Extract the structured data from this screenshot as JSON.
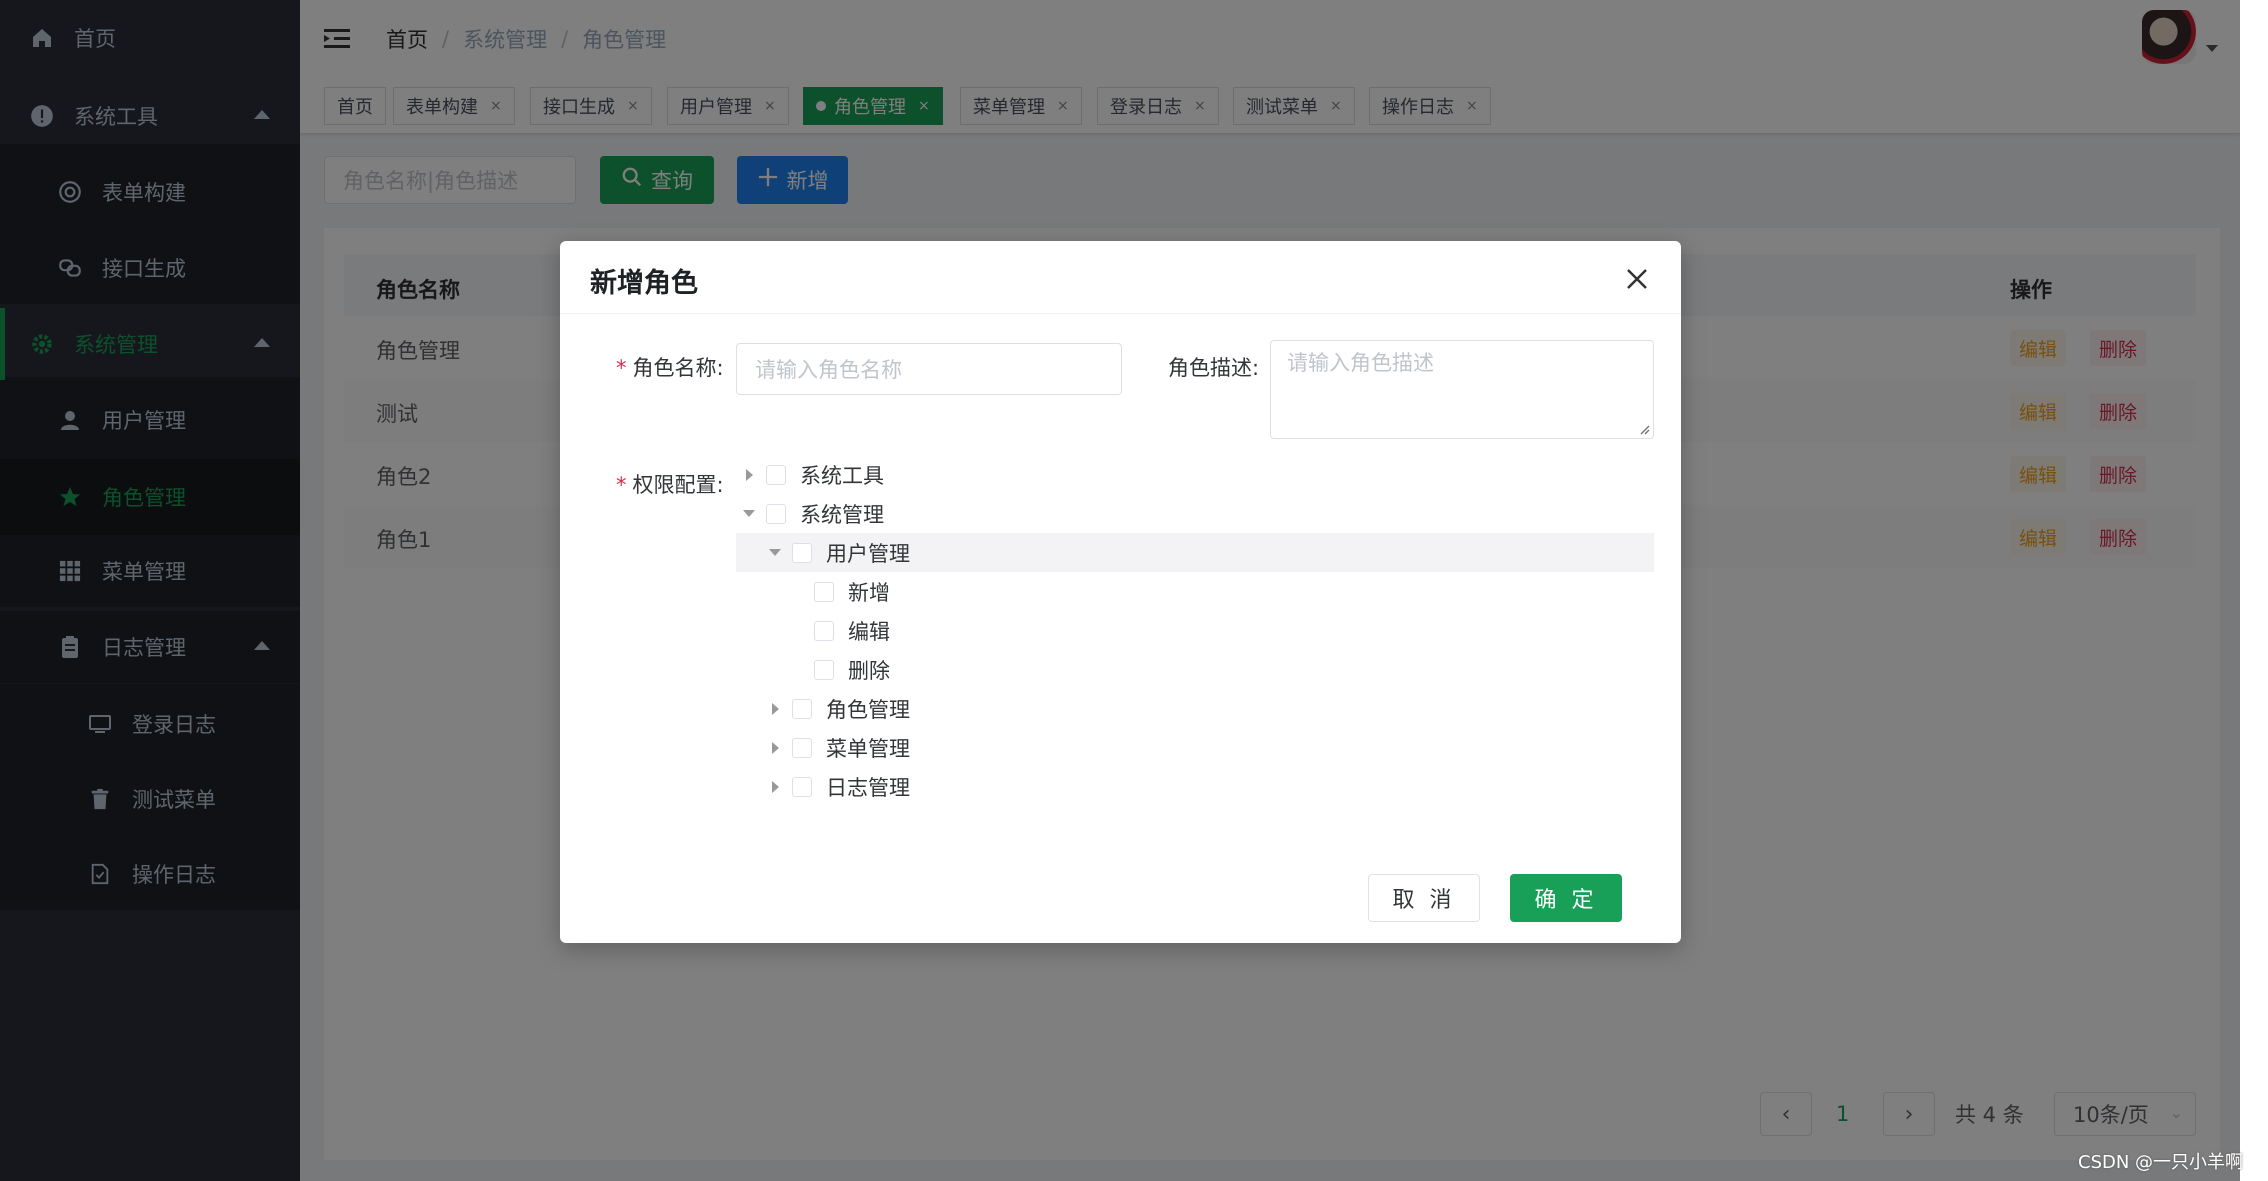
{
  "sidebar": {
    "items": [
      {
        "label": "首页",
        "icon": "home-icon"
      },
      {
        "label": "系统工具",
        "icon": "info-icon"
      },
      {
        "label": "表单构建",
        "icon": "circle-icon"
      },
      {
        "label": "接口生成",
        "icon": "link-icon"
      },
      {
        "label": "系统管理",
        "icon": "gear-icon"
      },
      {
        "label": "用户管理",
        "icon": "user-icon"
      },
      {
        "label": "角色管理",
        "icon": "star-icon"
      },
      {
        "label": "菜单管理",
        "icon": "grid-icon"
      },
      {
        "label": "日志管理",
        "icon": "clipboard-icon"
      },
      {
        "label": "登录日志",
        "icon": "monitor-icon"
      },
      {
        "label": "测试菜单",
        "icon": "trash-icon"
      },
      {
        "label": "操作日志",
        "icon": "document-check-icon"
      }
    ]
  },
  "header": {
    "breadcrumb": [
      "首页",
      "系统管理",
      "角色管理"
    ]
  },
  "tabs": [
    {
      "label": "首页"
    },
    {
      "label": "表单构建"
    },
    {
      "label": "接口生成"
    },
    {
      "label": "用户管理"
    },
    {
      "label": "角色管理"
    },
    {
      "label": "菜单管理"
    },
    {
      "label": "登录日志"
    },
    {
      "label": "测试菜单"
    },
    {
      "label": "操作日志"
    }
  ],
  "toolbar": {
    "search_placeholder": "角色名称|角色描述",
    "query_label": "查询",
    "add_label": "新增"
  },
  "table": {
    "headers": {
      "name": "角色名称",
      "actions": "操作"
    },
    "rows": [
      {
        "name": "角色管理"
      },
      {
        "name": "测试"
      },
      {
        "name": "角色2"
      },
      {
        "name": "角色1"
      }
    ],
    "edit_label": "编辑",
    "delete_label": "删除"
  },
  "pagination": {
    "current": "1",
    "total": "共 4 条",
    "size": "10条/页"
  },
  "modal": {
    "title": "新增角色",
    "name_label": "角色名称:",
    "name_placeholder": "请输入角色名称",
    "desc_label": "角色描述:",
    "desc_placeholder": "请输入角色描述",
    "perm_label": "权限配置:",
    "tree": [
      {
        "label": "系统工具"
      },
      {
        "label": "系统管理"
      },
      {
        "label": "用户管理"
      },
      {
        "label": "新增"
      },
      {
        "label": "编辑"
      },
      {
        "label": "删除"
      },
      {
        "label": "角色管理"
      },
      {
        "label": "菜单管理"
      },
      {
        "label": "日志管理"
      }
    ],
    "cancel_label": "取 消",
    "ok_label": "确 定"
  },
  "watermark": "CSDN @一只小羊啊",
  "colors": {
    "primary": "#18a058",
    "info": "#2080f0",
    "warning": "#f0a020",
    "danger": "#d03050"
  }
}
